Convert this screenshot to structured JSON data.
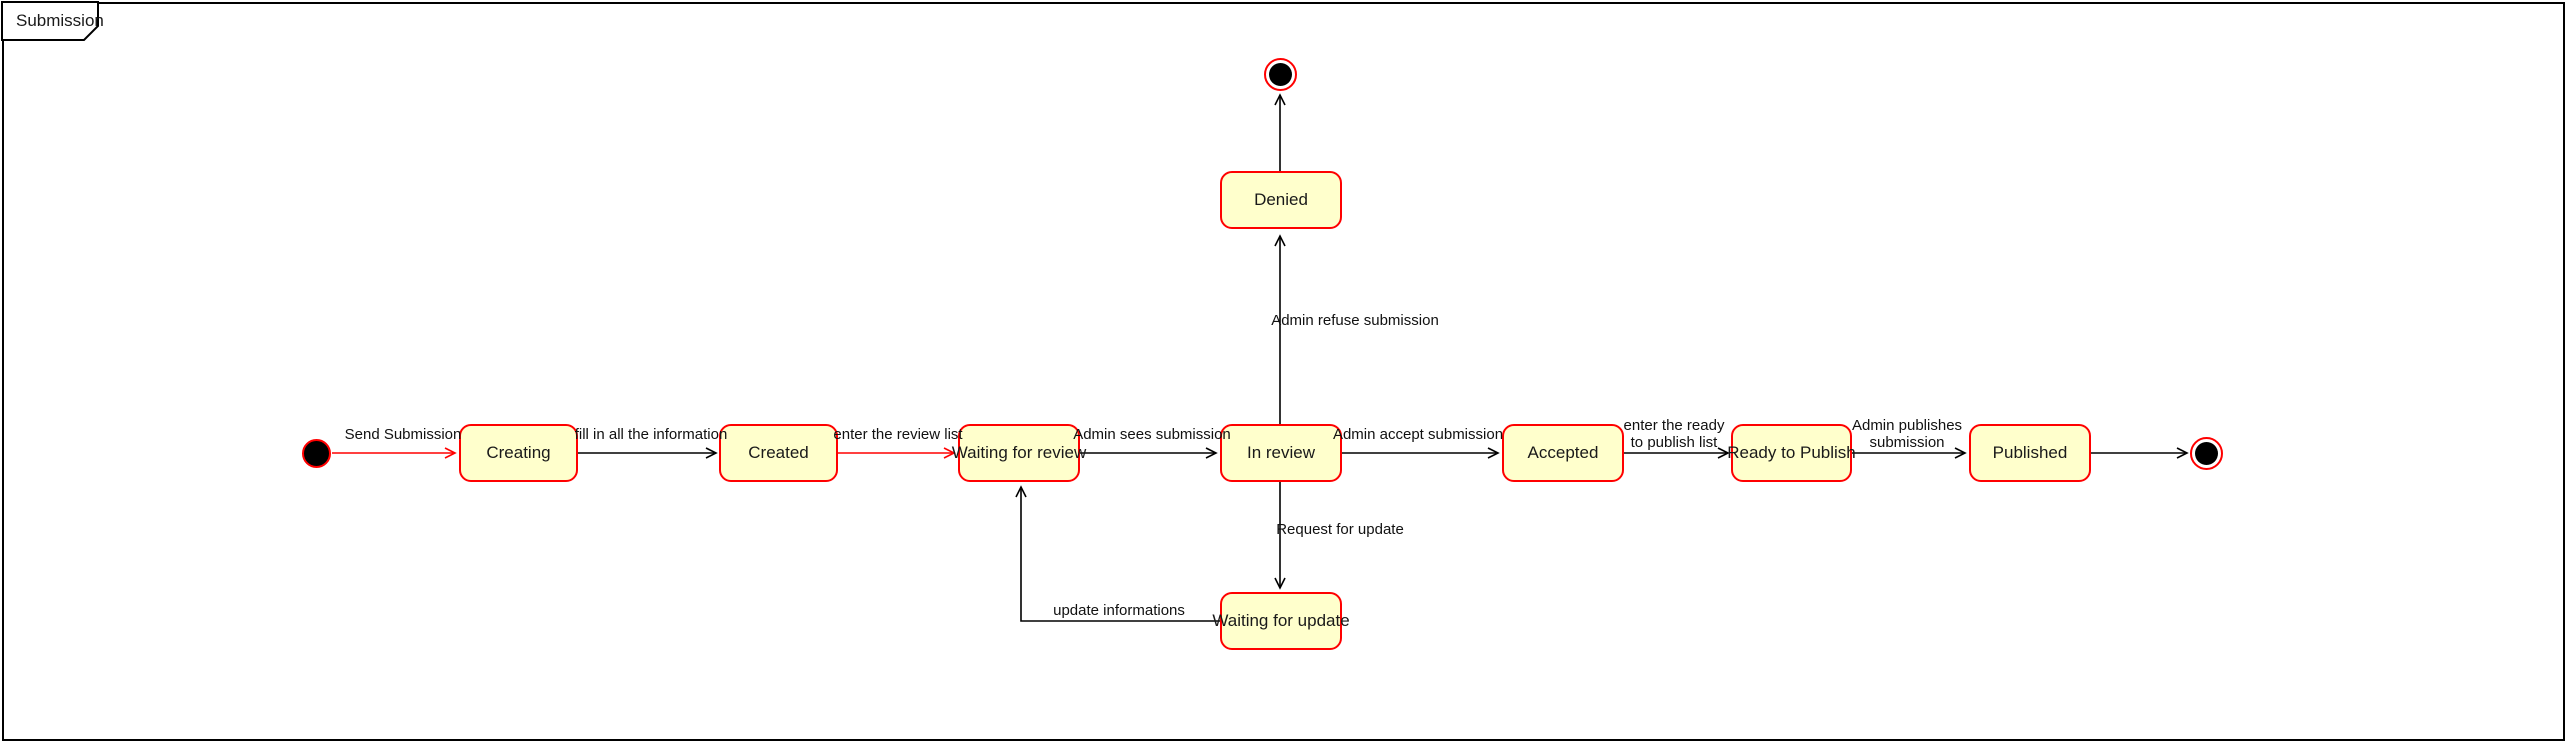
{
  "frame": {
    "title": "Submission"
  },
  "colors": {
    "state_fill": "#FFFFCC",
    "state_border": "#FF0000",
    "edge_black": "#000000",
    "edge_red": "#FF0000",
    "canvas": "#FFFFFF",
    "text": "#111111"
  },
  "diagram": {
    "type": "state-machine",
    "nodes": [
      {
        "id": "initial",
        "kind": "initial-state",
        "label": ""
      },
      {
        "id": "creating",
        "kind": "state",
        "label": "Creating"
      },
      {
        "id": "created",
        "kind": "state",
        "label": "Created"
      },
      {
        "id": "waiting_for_review",
        "kind": "state",
        "label": "Waiting for review"
      },
      {
        "id": "in_review",
        "kind": "state",
        "label": "In review"
      },
      {
        "id": "accepted",
        "kind": "state",
        "label": "Accepted"
      },
      {
        "id": "ready_to_publish",
        "kind": "state",
        "label": "Ready to Publish"
      },
      {
        "id": "published",
        "kind": "state",
        "label": "Published"
      },
      {
        "id": "denied",
        "kind": "state",
        "label": "Denied"
      },
      {
        "id": "waiting_for_update",
        "kind": "state",
        "label": "Waiting for update"
      },
      {
        "id": "final_main",
        "kind": "final-state",
        "label": ""
      },
      {
        "id": "final_denied",
        "kind": "final-state",
        "label": ""
      }
    ],
    "transitions": [
      {
        "id": "t1",
        "from": "initial",
        "to": "creating",
        "label": "Send Submission",
        "color": "#FF0000"
      },
      {
        "id": "t2",
        "from": "creating",
        "to": "created",
        "label": "fill in all the information",
        "color": "#000000"
      },
      {
        "id": "t3",
        "from": "created",
        "to": "waiting_for_review",
        "label": "enter the review list",
        "color": "#FF0000"
      },
      {
        "id": "t4",
        "from": "waiting_for_review",
        "to": "in_review",
        "label": "Admin sees submission",
        "color": "#000000"
      },
      {
        "id": "t5",
        "from": "in_review",
        "to": "accepted",
        "label": "Admin accept submission",
        "color": "#000000"
      },
      {
        "id": "t6",
        "from": "accepted",
        "to": "ready_to_publish",
        "label": "enter the ready\nto publish list",
        "color": "#000000"
      },
      {
        "id": "t7",
        "from": "ready_to_publish",
        "to": "published",
        "label": "Admin publishes\nsubmission",
        "color": "#000000"
      },
      {
        "id": "t8",
        "from": "published",
        "to": "final_main",
        "label": "",
        "color": "#000000"
      },
      {
        "id": "t9",
        "from": "in_review",
        "to": "denied",
        "label": "Admin refuse submission",
        "color": "#000000"
      },
      {
        "id": "t10",
        "from": "denied",
        "to": "final_denied",
        "label": "",
        "color": "#000000"
      },
      {
        "id": "t11",
        "from": "in_review",
        "to": "waiting_for_update",
        "label": "Request for update",
        "color": "#000000"
      },
      {
        "id": "t12",
        "from": "waiting_for_update",
        "to": "waiting_for_review",
        "label": "update informations",
        "color": "#000000"
      }
    ]
  }
}
